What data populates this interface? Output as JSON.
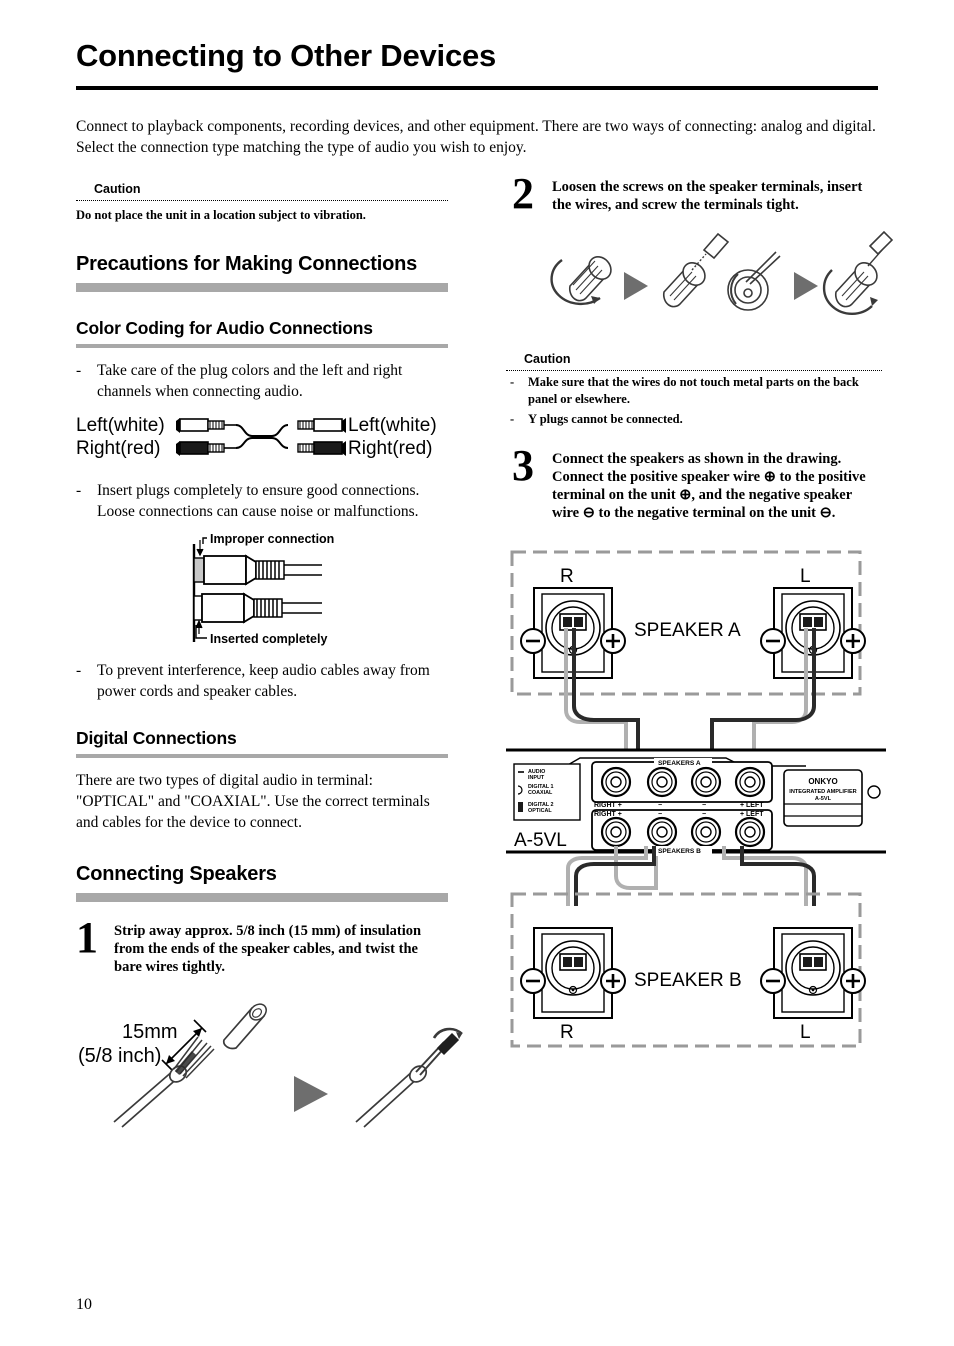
{
  "page": {
    "title": "Connecting to Other Devices",
    "number": "10",
    "intro": "Connect to playback components, recording devices, and other equipment. There are two ways of connecting: analog and digital. Select the connection type matching the type of audio you wish to enjoy."
  },
  "left": {
    "caution": {
      "label": "Caution",
      "text": "Do not place the unit in a location subject to vibration."
    },
    "section_precautions": "Precautions for Making Connections",
    "sub_color_coding": "Color Coding for Audio Connections",
    "bullet_plug_colors": "Take care of the plug colors and the left and right channels when connecting audio.",
    "cable_diagram": {
      "left_top": "Left(white)",
      "left_bottom": "Right(red)",
      "right_top": "Left(white)",
      "right_bottom": "Right(red)"
    },
    "bullet_insert_plugs": "Insert plugs completely to ensure good connections. Loose connections can cause noise or malfunctions.",
    "plug_diagram": {
      "improper": "Improper connection",
      "inserted": "Inserted completely"
    },
    "bullet_interference": "To prevent interference, keep audio cables away from power cords and speaker cables.",
    "sub_digital": "Digital Connections",
    "digital_text": "There are two types of digital audio in terminal: \"OPTICAL\" and \"COAXIAL\". Use the correct terminals and cables for the device to connect.",
    "section_speakers": "Connecting Speakers",
    "step1": {
      "number": "1",
      "text": "Strip away approx. 5/8 inch (15 mm) of insulation from the ends of the speaker cables, and twist the bare wires tightly."
    },
    "step1_figure": {
      "dim_mm": "15mm",
      "dim_inch": "(5/8 inch)"
    }
  },
  "right": {
    "step2": {
      "number": "2",
      "text": "Loosen the screws on the speaker terminals, insert the wires, and screw the terminals tight."
    },
    "caution": {
      "label": "Caution",
      "items": [
        "Make sure that the wires do not touch metal parts on the back panel or elsewhere.",
        "Y plugs cannot be connected."
      ]
    },
    "step3": {
      "number": "3",
      "text": "Connect the speakers as shown in the drawing. Connect the positive speaker wire ⊕ to the positive terminal on the unit ⊕, and the negative speaker wire ⊖ to the negative terminal on the unit ⊖."
    },
    "speaker_diagram": {
      "speaker_a_label": "SPEAKER A",
      "speaker_b_label": "SPEAKER B",
      "a_left_channel": "R",
      "a_right_channel": "L",
      "b_left_channel": "R",
      "b_right_channel": "L",
      "plus_sign": "+",
      "minus_sign": "−",
      "amp_model": "A-5VL",
      "amp_panel": {
        "speakers_a": "SPEAKERS A",
        "speakers_b": "SPEAKERS B",
        "row_a_labels": [
          "RIGHT +",
          "−",
          "−",
          "+ LEFT"
        ],
        "row_b_labels": [
          "RIGHT +",
          "−",
          "−",
          "+ LEFT"
        ],
        "jack_labels": [
          "AUDIO INPUT",
          "DIGITAL 1 COAXIAL",
          "DIGITAL 2 OPTICAL"
        ],
        "brand": "ONKYO",
        "brand_sub": "INTEGRATED AMPLIFIER",
        "brand_model": "A-5VL"
      }
    }
  },
  "colors": {
    "heading_bar": "#a8a8a8",
    "rule": "#000000",
    "dashed_box": "#9a9a9a",
    "arrow_fill": "#6e6e6e"
  }
}
